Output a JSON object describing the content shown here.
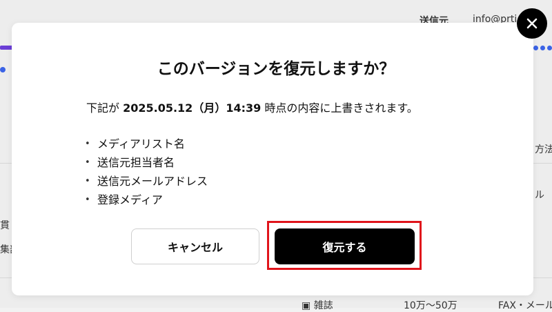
{
  "background": {
    "sender_label": "送信元",
    "sender_email": "info@prti...co",
    "method_fragment": "方法",
    "col_fragment_l": "ル",
    "left_frag_1": "貫し",
    "left_frag_2": "集部",
    "row_type": "雑誌",
    "row_range": "10万～50万",
    "row_contact": "FAX・メール"
  },
  "modal": {
    "title": "このバージョンを復元しますか？",
    "desc_prefix": "下記が ",
    "desc_timestamp": "2025.05.12（月）14:39",
    "desc_suffix": " 時点の内容に上書きされます。",
    "items": [
      "メディアリスト名",
      "送信元担当者名",
      "送信元メールアドレス",
      "登録メディア"
    ],
    "cancel_label": "キャンセル",
    "restore_label": "復元する"
  },
  "colors": {
    "primary": "#000000",
    "highlight": "#e0141b",
    "accent_purple": "#6b3fd6",
    "accent_blue": "#3b63e6"
  }
}
